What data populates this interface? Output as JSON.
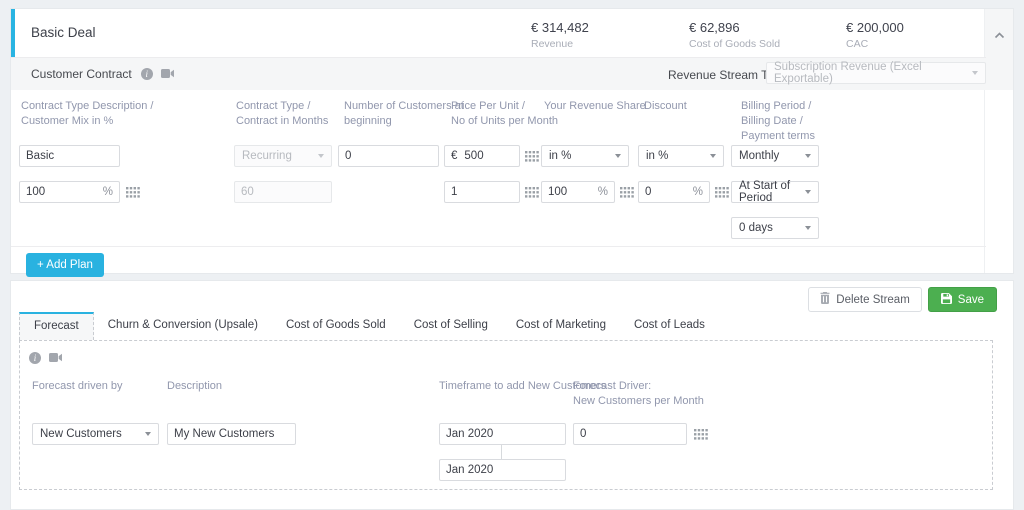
{
  "header": {
    "title": "Basic Deal",
    "metrics": [
      {
        "value": "€ 314,482",
        "label": "Revenue"
      },
      {
        "value": "€ 62,896",
        "label": "Cost of Goods Sold"
      },
      {
        "value": "€ 200,000",
        "label": "CAC"
      }
    ]
  },
  "contract": {
    "title": "Customer Contract",
    "revenue_stream": {
      "label": "Revenue Stream Type",
      "value": "Subscription Revenue (Excel Exportable)"
    },
    "columns": [
      "Contract Type Description /\nCustomer Mix in %",
      "Contract Type /\nContract in Months",
      "Number of Customers at\nbeginning",
      "Price Per Unit /\nNo of Units per Month",
      "Your Revenue Share",
      "Discount",
      "Billing Period /\nBilling Date /\nPayment terms"
    ],
    "fields": {
      "description": "Basic",
      "contract_type": "Recurring",
      "customers_beginning": "0",
      "price_prefix": "€",
      "price_per_unit": "500",
      "revenue_share_unit": "in %",
      "discount_unit": "in %",
      "billing_period": "Monthly",
      "customer_mix": "100",
      "customer_mix_suffix": "%",
      "contract_months": "60",
      "units_per_month": "1",
      "revenue_share": "100",
      "revenue_share_suffix": "%",
      "discount": "0",
      "discount_suffix": "%",
      "billing_date": "At Start of Period",
      "payment_terms": "0 days"
    },
    "add_plan_label": "+ Add Plan"
  },
  "stream_actions": {
    "delete_label": "Delete Stream",
    "save_label": "Save"
  },
  "tabs": {
    "items": [
      "Forecast",
      "Churn & Conversion (Upsale)",
      "Cost of Goods Sold",
      "Cost of Selling",
      "Cost of Marketing",
      "Cost of Leads"
    ]
  },
  "forecast": {
    "labels": {
      "driven_by": "Forecast driven by",
      "description": "Description",
      "timeframe": "Timeframe to add New Customers",
      "driver": "Forecast Driver:\nNew Customers per Month"
    },
    "fields": {
      "driven_by": "New Customers",
      "description": "My New Customers",
      "timeframe_start": "Jan 2020",
      "timeframe_end": "Jan 2020",
      "driver_value": "0"
    }
  },
  "colors": {
    "accent_blue": "#29b2e0",
    "save_green": "#4caf50",
    "header_label": "#9197ad"
  }
}
